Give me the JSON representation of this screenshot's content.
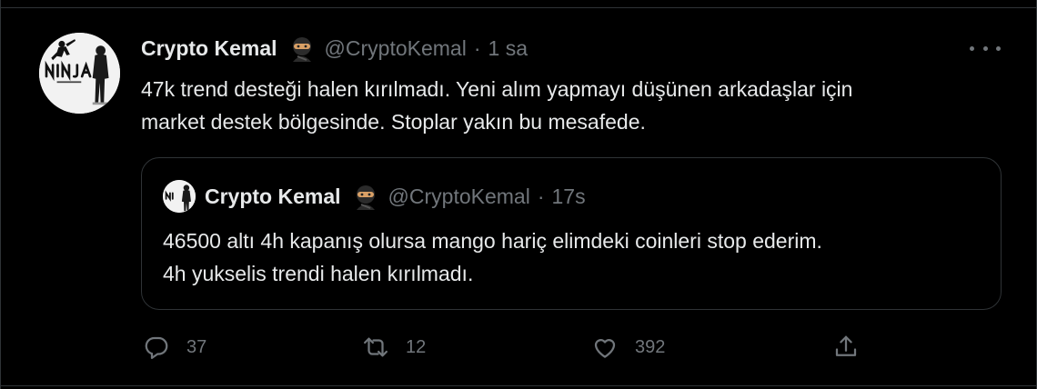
{
  "tweet": {
    "author_name": "Crypto Kemal",
    "author_emoji": "🥷",
    "author_handle": "@CryptoKemal",
    "separator": "·",
    "time": "1 sa",
    "text": "47k trend desteği halen kırılmadı. Yeni alım yapmayı düşünen arkadaşlar için\nmarket destek bölgesinde. Stoplar yakın bu mesafede.",
    "avatar_logo_text": "NINJA",
    "avatar_logo_subtext": "TRADERS",
    "more_icon": "more-horizontal-icon"
  },
  "quoted_tweet": {
    "author_name": "Crypto Kemal",
    "author_emoji": "🥷",
    "author_handle": "@CryptoKemal",
    "separator": "·",
    "time": "17s",
    "text": "46500 altı 4h kapanış olursa mango hariç elimdeki coinleri stop ederim.\n4h yukselis trendi halen kırılmadı."
  },
  "actions": {
    "reply": {
      "icon": "reply-icon",
      "count": "37"
    },
    "retweet": {
      "icon": "retweet-icon",
      "count": "12"
    },
    "like": {
      "icon": "heart-icon",
      "count": "392"
    },
    "share": {
      "icon": "share-icon"
    }
  },
  "colors": {
    "background": "#000000",
    "text_primary": "#e7e9ea",
    "text_secondary": "#71767b",
    "border": "#2f3336"
  }
}
